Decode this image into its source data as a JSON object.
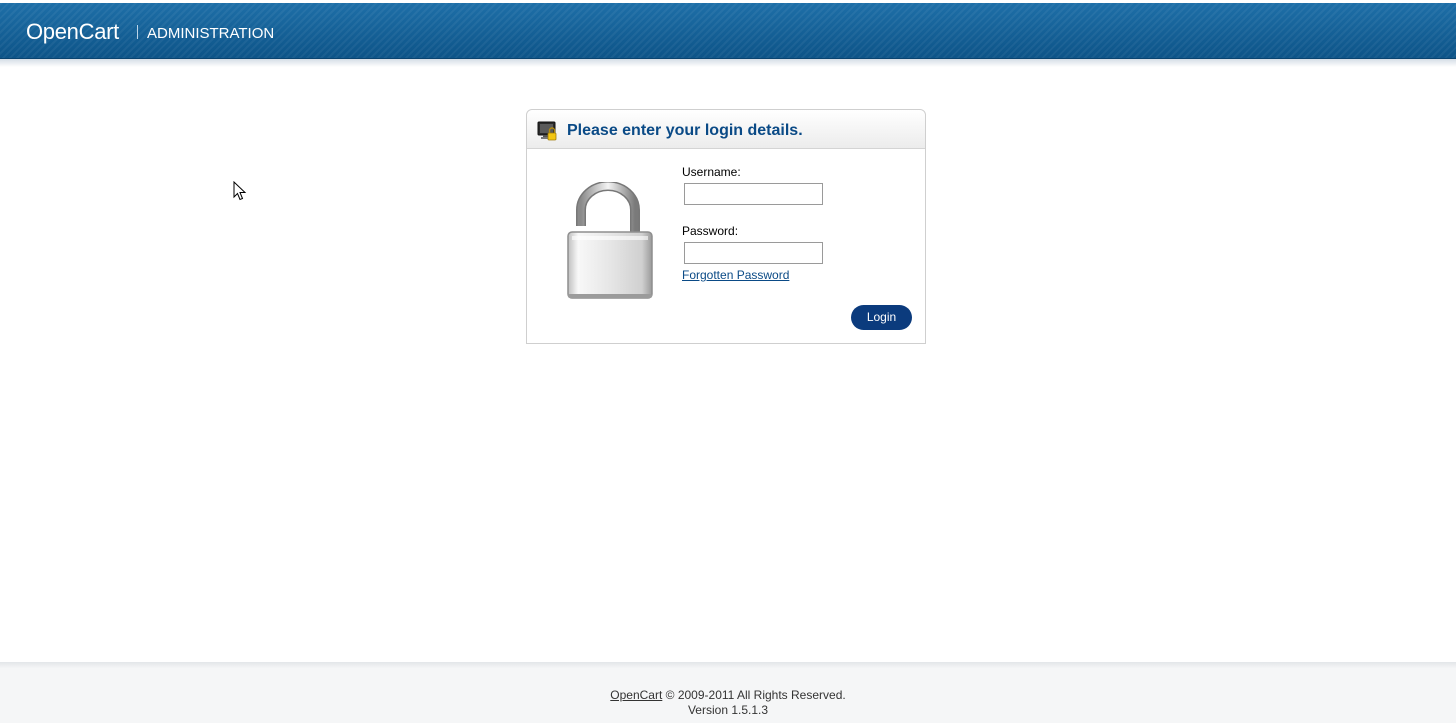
{
  "header": {
    "logo_text": "OpenCart",
    "section_text": "ADMINISTRATION",
    "icon": "opencart-logo"
  },
  "login": {
    "heading": "Please enter your login details.",
    "heading_icon": "lock-screen-icon",
    "image_icon": "padlock-open-icon",
    "username_label": "Username:",
    "username_value": "",
    "password_label": "Password:",
    "password_value": "",
    "forgotten_link": "Forgotten Password",
    "button_label": "Login"
  },
  "footer": {
    "brand_link": "OpenCart",
    "copyright": "© 2009-2011 All Rights Reserved.",
    "version": "Version 1.5.1.3"
  },
  "colors": {
    "header_blue": "#0d5488",
    "heading_text": "#0a4a86",
    "button": "#0b3b7d"
  }
}
